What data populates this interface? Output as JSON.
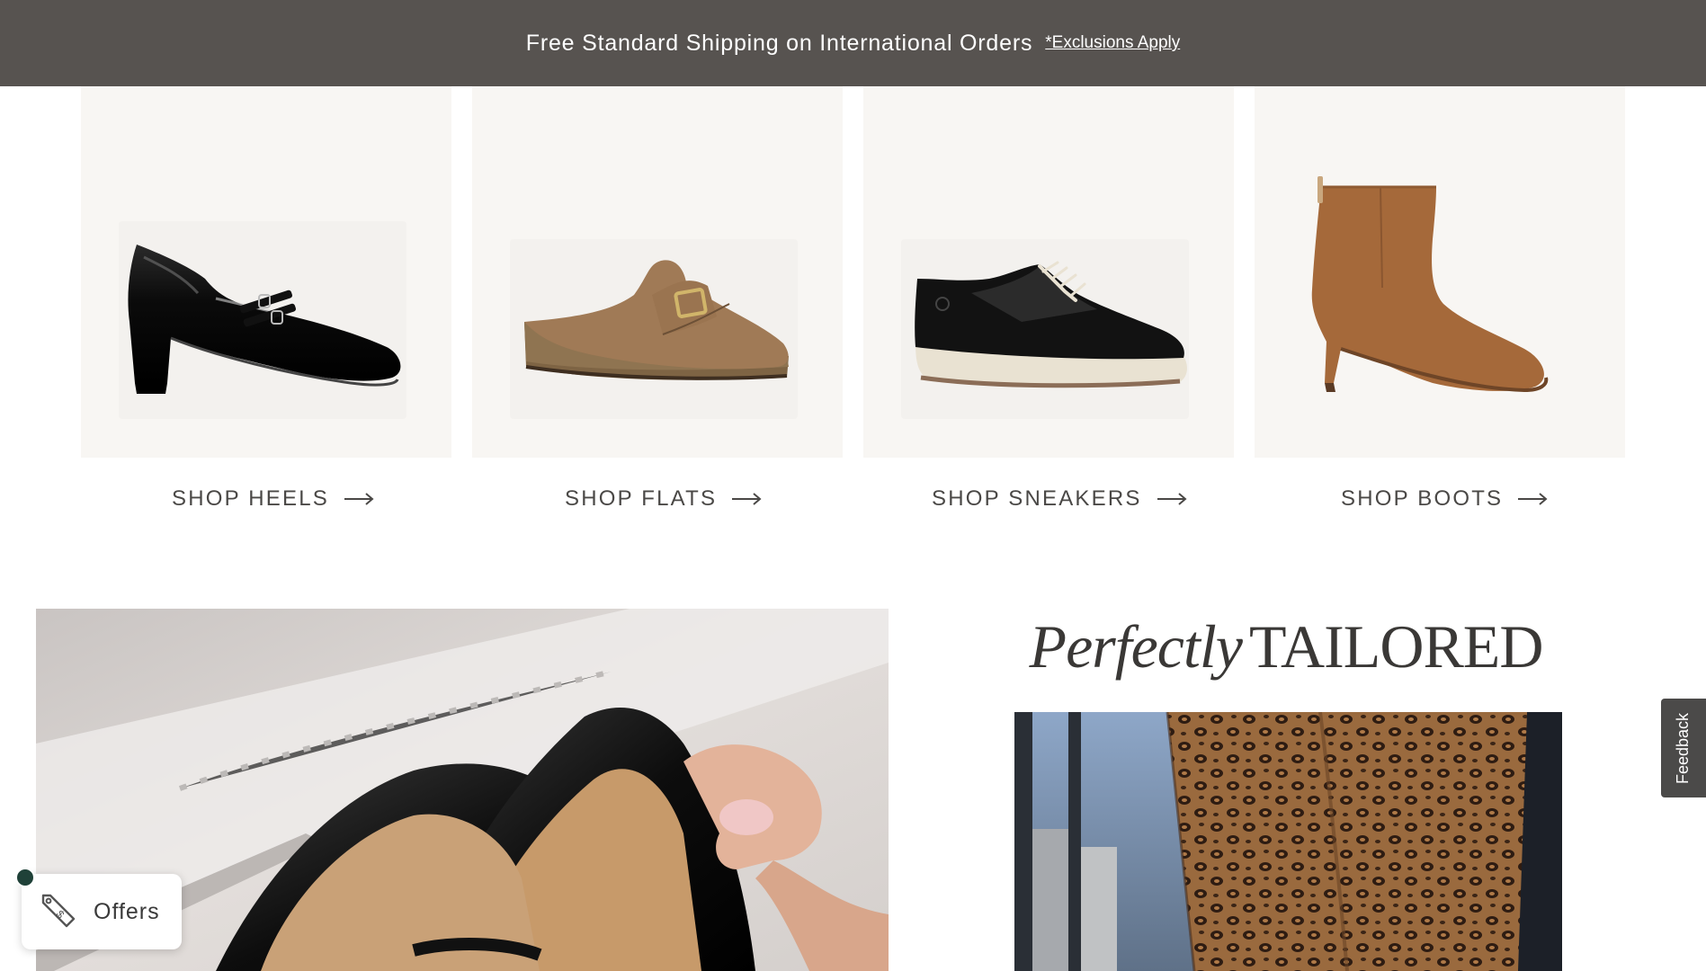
{
  "banner": {
    "message": "Free Standard Shipping on International Orders",
    "link": "*Exclusions Apply"
  },
  "categories": [
    {
      "label": "SHOP HEELS",
      "icon": "heel-shoe-image"
    },
    {
      "label": "SHOP FLATS",
      "icon": "clog-flat-image"
    },
    {
      "label": "SHOP SNEAKERS",
      "icon": "sneaker-image"
    },
    {
      "label": "SHOP BOOTS",
      "icon": "bootie-image"
    }
  ],
  "feature": {
    "title_italic": "Perfectly",
    "title_caps": "TAILORED"
  },
  "feedback": {
    "label": "Feedback"
  },
  "offers": {
    "label": "Offers",
    "icon": "price-tag-icon"
  },
  "colors": {
    "banner_bg": "#575350",
    "tile_bg": "#f8f6f3",
    "offers_dot": "#1f4138"
  }
}
